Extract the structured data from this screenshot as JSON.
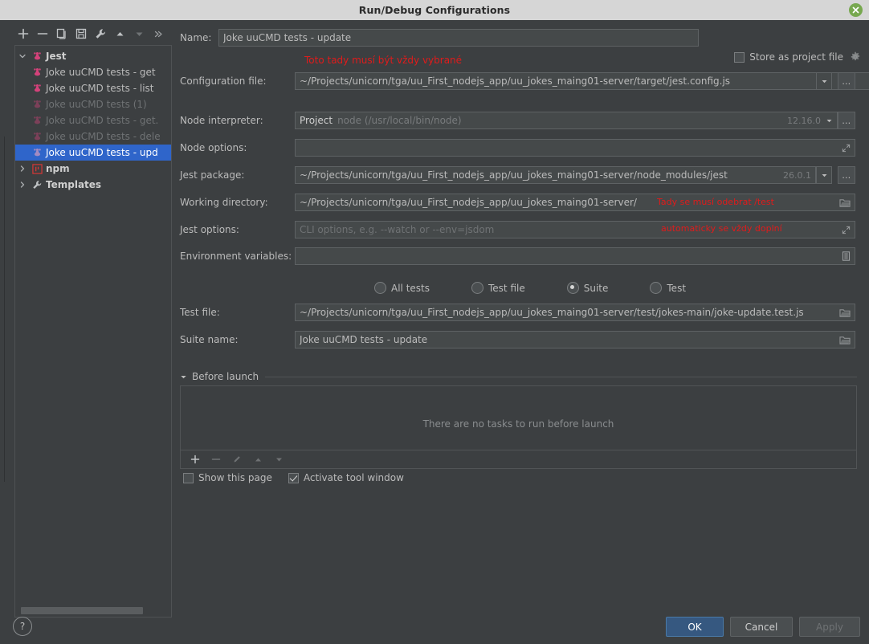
{
  "window": {
    "title": "Run/Debug Configurations",
    "close_label": "✕"
  },
  "toolbar": {
    "buttons": [
      {
        "name": "add",
        "glyph": "+"
      },
      {
        "name": "remove",
        "glyph": "−"
      },
      {
        "name": "copy",
        "glyph": "copy"
      },
      {
        "name": "save",
        "glyph": "save"
      },
      {
        "name": "edit-templates",
        "glyph": "wrench"
      },
      {
        "name": "move-up",
        "glyph": "▲"
      },
      {
        "name": "move-down",
        "glyph": "▼"
      },
      {
        "name": "more",
        "glyph": "»"
      }
    ]
  },
  "tree": {
    "items": [
      {
        "label": "Jest",
        "level": 0,
        "arrow": "down",
        "icon": "jest-icon",
        "bold": true,
        "dim": false,
        "selected": false
      },
      {
        "label": "Joke uuCMD tests - get",
        "level": 1,
        "arrow": "",
        "icon": "jest-icon",
        "bold": false,
        "dim": false,
        "selected": false
      },
      {
        "label": "Joke uuCMD tests - list",
        "level": 1,
        "arrow": "",
        "icon": "jest-icon",
        "bold": false,
        "dim": false,
        "selected": false
      },
      {
        "label": "Joke uuCMD tests (1)",
        "level": 1,
        "arrow": "",
        "icon": "jest-icon",
        "bold": false,
        "dim": true,
        "selected": false
      },
      {
        "label": "Joke uuCMD tests - get.",
        "level": 1,
        "arrow": "",
        "icon": "jest-icon",
        "bold": false,
        "dim": true,
        "selected": false
      },
      {
        "label": "Joke uuCMD tests - dele",
        "level": 1,
        "arrow": "",
        "icon": "jest-icon",
        "bold": false,
        "dim": true,
        "selected": false
      },
      {
        "label": "Joke uuCMD tests - upd",
        "level": 1,
        "arrow": "",
        "icon": "jest-icon",
        "bold": false,
        "dim": false,
        "selected": true
      },
      {
        "label": "npm",
        "level": 0,
        "arrow": "right",
        "icon": "npm-icon",
        "bold": true,
        "dim": false,
        "selected": false
      },
      {
        "label": "Templates",
        "level": 0,
        "arrow": "right",
        "icon": "wrench-icon",
        "bold": true,
        "dim": false,
        "selected": false
      }
    ]
  },
  "form": {
    "name_label": "Name:",
    "name_value": "Joke uuCMD tests - update",
    "store_checkbox_label": "Store as project file",
    "store_checked": false,
    "annotation_name": "Toto tady musí být vždy vybrané",
    "configuration_file_label": "Configuration file:",
    "configuration_file_value": "~/Projects/unicorn/tga/uu_First_nodejs_app/uu_jokes_maing01-server/target/jest.config.js",
    "node_interpreter_label": "Node interpreter:",
    "node_interpreter_prefix": "Project",
    "node_interpreter_value": "node (/usr/local/bin/node)",
    "node_interpreter_version": "12.16.0",
    "node_options_label": "Node options:",
    "node_options_value": "",
    "jest_package_label": "Jest package:",
    "jest_package_value": "~/Projects/unicorn/tga/uu_First_nodejs_app/uu_jokes_maing01-server/node_modules/jest",
    "jest_package_version": "26.0.1",
    "working_directory_label": "Working directory:",
    "working_directory_value": "~/Projects/unicorn/tga/uu_First_nodejs_app/uu_jokes_maing01-server/",
    "annotation_working_directory": "Tady se musí odebrat /test",
    "jest_options_label": "Jest options:",
    "jest_options_placeholder": "CLI options, e.g. --watch or --env=jsdom",
    "jest_options_value": "",
    "annotation_jest_options": "automaticky se vždy doplní",
    "environment_variables_label": "Environment variables:",
    "environment_variables_value": "",
    "scope_options": [
      {
        "label": "All tests",
        "selected": false
      },
      {
        "label": "Test file",
        "selected": false
      },
      {
        "label": "Suite",
        "selected": true
      },
      {
        "label": "Test",
        "selected": false
      }
    ],
    "test_file_label": "Test file:",
    "test_file_value": "~/Projects/unicorn/tga/uu_First_nodejs_app/uu_jokes_maing01-server/test/jokes-main/joke-update.test.js",
    "suite_name_label": "Suite name:",
    "suite_name_value": "Joke uuCMD tests - update",
    "before_launch_label": "Before launch",
    "before_launch_empty": "There are no tasks to run before launch",
    "before_launch_toolbar": [
      {
        "name": "add-task",
        "glyph": "+",
        "disabled": false
      },
      {
        "name": "remove-task",
        "glyph": "−",
        "disabled": true
      },
      {
        "name": "edit-task",
        "glyph": "pencil",
        "disabled": true
      },
      {
        "name": "move-task-up",
        "glyph": "▲",
        "disabled": true
      },
      {
        "name": "move-task-down",
        "glyph": "▼",
        "disabled": true
      }
    ],
    "show_this_page_label": "Show this page",
    "show_this_page_checked": false,
    "activate_tool_window_label": "Activate tool window",
    "activate_tool_window_checked": true
  },
  "buttons": {
    "help": "?",
    "ok": "OK",
    "cancel": "Cancel",
    "apply": "Apply"
  },
  "colors": {
    "background": "#3c3f41",
    "field_background": "#45494a",
    "selection": "#2f65ca",
    "primary_button": "#365880",
    "annotation_red": "#e01b1b",
    "titlebar": "#d6d6d6",
    "close_green": "#77a84f",
    "jest_icon": "#d4427a",
    "npm_icon": "#cb3837"
  }
}
